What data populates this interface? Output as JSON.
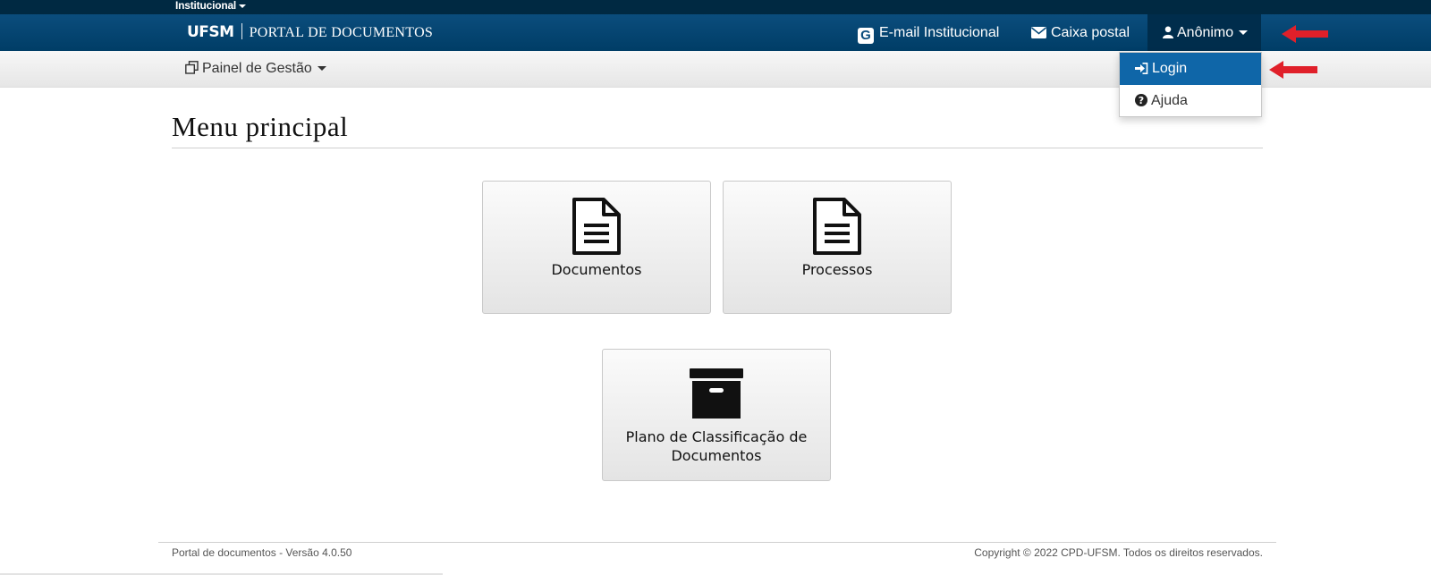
{
  "topbar": {
    "institucional": "Institucional"
  },
  "navbar": {
    "brand_ufsm": "UFSM",
    "brand_portal": "PORTAL DE DOCUMENTOS",
    "email_label": "E-mail Institucional",
    "caixa_label": "Caixa postal",
    "user_label": "Anônimo"
  },
  "subbar": {
    "painel_label": "Painel de Gestão"
  },
  "dropdown": {
    "items": [
      {
        "label": "Login",
        "icon": "sign-in-icon",
        "active": true
      },
      {
        "label": "Ajuda",
        "icon": "question-circle-icon",
        "active": false
      }
    ]
  },
  "main": {
    "title": "Menu principal",
    "tiles": [
      {
        "label": "Documentos",
        "icon": "document-icon"
      },
      {
        "label": "Processos",
        "icon": "document-icon"
      },
      {
        "label": "Plano de Classificação de Documentos",
        "icon": "archive-box-icon"
      }
    ]
  },
  "footer": {
    "left": "Portal de documentos - Versão 4.0.50",
    "right": "Copyright © 2022 CPD-UFSM. Todos os direitos reservados."
  },
  "colors": {
    "navbar": "#003d66",
    "topstrip": "#002942",
    "dropdown_active": "#0f66a8",
    "annotation_arrow": "#e0202a"
  }
}
